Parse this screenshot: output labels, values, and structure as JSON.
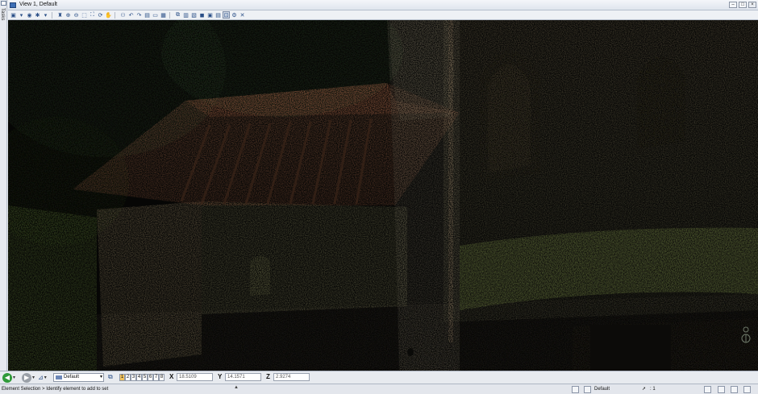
{
  "tasks_label": "Tasks",
  "window": {
    "title": "View 1, Default",
    "min": "–",
    "max": "□",
    "close": "×"
  },
  "toolbar_icons": [
    "view-attributes-icon",
    "view-display-icon",
    "render-icon",
    "pan-icon",
    "zoom-in-icon",
    "zoom-out-icon",
    "window-area-icon",
    "fit-view-icon",
    "rotate-view-icon",
    "walk-icon",
    "previous-view-icon",
    "next-view-icon",
    "view-orientation-icon",
    "clip-volume-icon",
    "camera-icon",
    "display-style-icon",
    "level-display-icon",
    "copy-view-icon",
    "model-icon",
    "ambient-icon",
    "toggle-view-icon",
    "point-cloud-icon"
  ],
  "view_select": {
    "value": "Default"
  },
  "view_numbers": [
    "1",
    "2",
    "3",
    "4",
    "5",
    "6",
    "7",
    "8"
  ],
  "coords": {
    "x_label": "X",
    "x_value": "18.5109",
    "y_label": "Y",
    "y_value": "14.1571",
    "z_label": "Z",
    "z_value": "2.9274"
  },
  "status": {
    "message": "Element Selection > Identify element to add to set",
    "level": "Default",
    "scale": ": 1"
  }
}
